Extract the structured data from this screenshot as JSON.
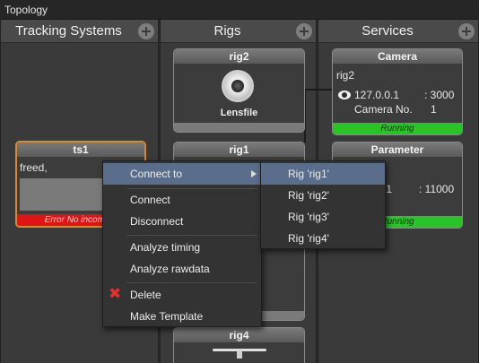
{
  "window": {
    "title": "Topology"
  },
  "columns": {
    "tracking": {
      "title": "Tracking Systems"
    },
    "rigs": {
      "title": "Rigs"
    },
    "services": {
      "title": "Services"
    }
  },
  "tracking_node": {
    "title": "ts1",
    "name": "freed,",
    "status": "Error No incoming"
  },
  "rig_nodes": [
    {
      "title": "rig2",
      "sub_label": "Lensfile"
    },
    {
      "title": "rig1"
    },
    {
      "title": "rig4"
    }
  ],
  "camera_service": {
    "title": "Camera",
    "rig": "rig2",
    "ip": "127.0.0.1",
    "port": ": 3000",
    "cam_label": "Camera No.",
    "cam_no": "1",
    "status": "Running"
  },
  "parameter_service": {
    "title": "Parameter",
    "ip_tail": ".1",
    "port": ": 11000",
    "status": "Running"
  },
  "context_menu": {
    "items": [
      {
        "label": "Connect to"
      },
      {
        "label": "Connect"
      },
      {
        "label": "Disconnect"
      },
      {
        "label": "Analyze timing"
      },
      {
        "label": "Analyze rawdata"
      },
      {
        "label": "Delete"
      },
      {
        "label": "Make Template"
      }
    ]
  },
  "submenu": {
    "items": [
      {
        "label": "Rig 'rig1'"
      },
      {
        "label": "Rig 'rig2'"
      },
      {
        "label": "Rig 'rig3'"
      },
      {
        "label": "Rig 'rig4'"
      }
    ]
  },
  "colors": {
    "running": "#28c428",
    "error": "#e01414",
    "menu_highlight": "#5a6e8c",
    "selected_border": "#d98a2a"
  },
  "icons": [
    "plus-circle-icon",
    "lens-icon",
    "eye-icon",
    "submenu-arrow-icon",
    "delete-x-icon",
    "tripod-icon"
  ]
}
